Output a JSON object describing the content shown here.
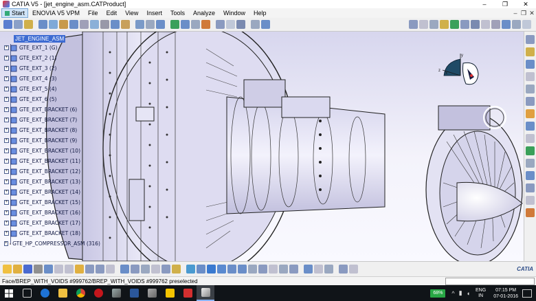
{
  "window": {
    "title": "CATIA V5 - [jet_engine_asm.CATProduct]",
    "controls": [
      "–",
      "❐",
      "✕"
    ]
  },
  "menubar": {
    "items": [
      "Start",
      "ENOVIA V5 VPM",
      "File",
      "Edit",
      "View",
      "Insert",
      "Tools",
      "Analyze",
      "Window",
      "Help"
    ],
    "doc_controls": [
      "–",
      "❐",
      "✕"
    ]
  },
  "tree": {
    "root": "JET_ENGINE_ASM",
    "nodes": [
      "GTE_EXT_1 (G)",
      "GTE_EXT_2 (1)",
      "GTE_EXT_3 (2)",
      "GTE_EXT_4 (3)",
      "GTE_EXT_5 (4)",
      "GTE_EXT_6 (5)",
      "GTE_EXT_BRACKET (6)",
      "GTE_EXT_BRACKET (7)",
      "GTE_EXT_BRACKET (8)",
      "GTE_EXT_BRACKET (9)",
      "GTE_EXT_BRACKET (10)",
      "GTE_EXT_BRACKET (11)",
      "GTE_EXT_BRACKET (12)",
      "GTE_EXT_BRACKET (13)",
      "GTE_EXT_BRACKET (14)",
      "GTE_EXT_BRACKET (15)",
      "GTE_EXT_BRACKET (16)",
      "GTE_EXT_BRACKET (17)",
      "GTE_EXT_BRACKET (18)",
      "GTE_HP_COMPRESSOR_ASM (316)"
    ]
  },
  "compass": {
    "axis_y": "y",
    "axis_z": "z",
    "axis_x": "x"
  },
  "status": {
    "message": "Face/BREP_WITH_VOIDS #999762/BREP_WITH_VOIDS #999762 preselected"
  },
  "bottom_logo": "CATIA",
  "taskbar": {
    "battery": "68%",
    "language": [
      "ENG",
      "IN"
    ],
    "time": "07:15 PM",
    "date": "07-01-2016"
  },
  "colors": {
    "tree_selected": "#3d6bd2",
    "viewport_top": "#d7d6ee",
    "taskbar": "#101418"
  }
}
